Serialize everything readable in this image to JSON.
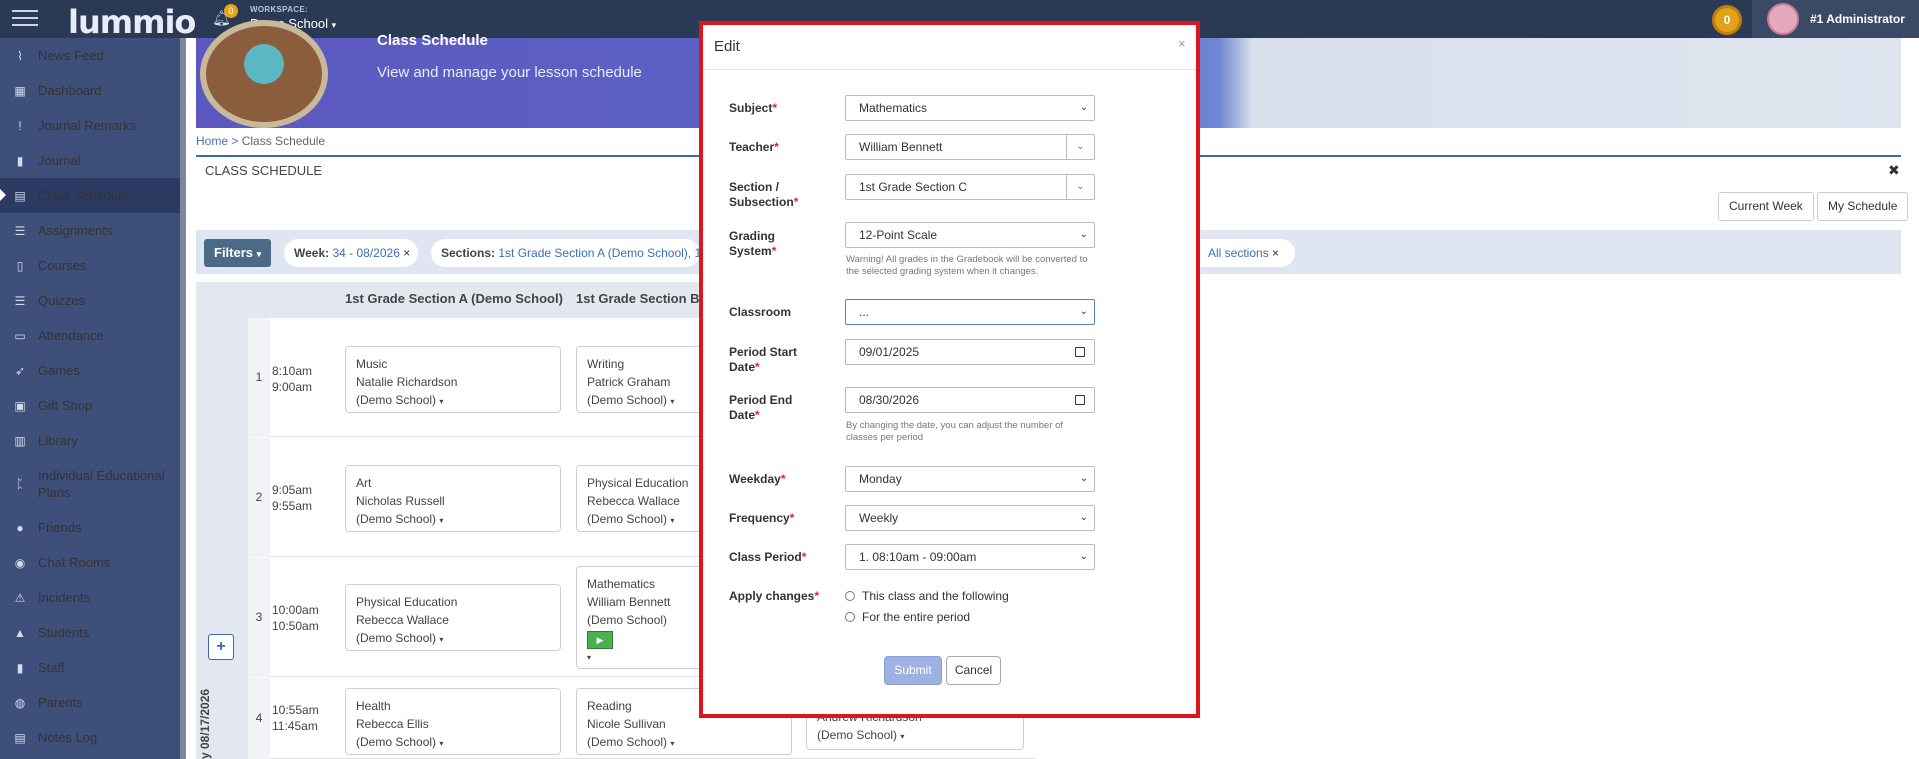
{
  "topbar": {
    "logo": "lummio",
    "notification_count": "0",
    "workspace_label": "WORKSPACE:",
    "workspace_name": "Demo School",
    "coins": "0",
    "username": "#1 Administrator"
  },
  "sidebar": {
    "items": [
      {
        "label": "News Feed",
        "icon": "rss-icon"
      },
      {
        "label": "Dashboard",
        "icon": "dashboard-icon"
      },
      {
        "label": "Journal Remarks",
        "icon": "exclamation-icon"
      },
      {
        "label": "Journal",
        "icon": "bookmark-icon"
      },
      {
        "label": "Class Schedule",
        "icon": "calendar-icon"
      },
      {
        "label": "Assignments",
        "icon": "list-icon"
      },
      {
        "label": "Courses",
        "icon": "book-icon"
      },
      {
        "label": "Quizzes",
        "icon": "list-icon"
      },
      {
        "label": "Attendance",
        "icon": "clipboard-icon"
      },
      {
        "label": "Games",
        "icon": "rocket-icon"
      },
      {
        "label": "Gift Shop",
        "icon": "gift-icon"
      },
      {
        "label": "Library",
        "icon": "library-icon"
      },
      {
        "label": "Individual Educational Plans",
        "icon": "plan-icon"
      },
      {
        "label": "Friends",
        "icon": "users-icon"
      },
      {
        "label": "Chat Rooms",
        "icon": "chat-icon"
      },
      {
        "label": "Incidents",
        "icon": "warning-icon"
      },
      {
        "label": "Students",
        "icon": "graduation-icon"
      },
      {
        "label": "Staff",
        "icon": "staff-icon"
      },
      {
        "label": "Parents",
        "icon": "parents-icon"
      },
      {
        "label": "Notes Log",
        "icon": "notes-icon"
      }
    ]
  },
  "page": {
    "banner_title": "Class Schedule",
    "banner_subtitle": "View and manage your lesson schedule",
    "breadcrumb_home": "Home",
    "breadcrumb_sep": ">",
    "breadcrumb_current": "Class Schedule",
    "schedule_title": "CLASS SCHEDULE",
    "current_week": "Current Week",
    "my_schedule": "My Schedule",
    "filters": "Filters",
    "week_key": "Week:",
    "week_value": "34 - 08/2026",
    "sections_key": "Sections:",
    "sections_value": "1st Grade Section A (Demo School), 1",
    "all_sections": "All sections",
    "col1": "1st Grade Section A (Demo School)",
    "col2": "1st Grade Section B",
    "week_label": "y 08/17/2026"
  },
  "rows": [
    {
      "num": "1",
      "start": "8:10am",
      "end": "9:00am",
      "a": {
        "subject": "Music",
        "teacher": "Natalie Richardson",
        "school": "(Demo School)"
      },
      "b": {
        "subject": "Writing",
        "teacher": "Patrick Graham",
        "school": "(Demo School)"
      }
    },
    {
      "num": "2",
      "start": "9:05am",
      "end": "9:55am",
      "a": {
        "subject": "Art",
        "teacher": "Nicholas Russell",
        "school": "(Demo School)"
      },
      "b": {
        "subject": "Physical Education",
        "teacher": "Rebecca Wallace",
        "school": "(Demo School)"
      }
    },
    {
      "num": "3",
      "start": "10:00am",
      "end": "10:50am",
      "a": {
        "subject": "Physical Education",
        "teacher": "Rebecca Wallace",
        "school": "(Demo School)"
      },
      "b": {
        "subject": "Mathematics",
        "teacher": "William Bennett",
        "school": "(Demo School)"
      }
    },
    {
      "num": "4",
      "start": "10:55am",
      "end": "11:45am",
      "a": {
        "subject": "Health",
        "teacher": "Rebecca Ellis",
        "school": "(Demo School)"
      },
      "b": {
        "subject": "Reading",
        "teacher": "Nicole Sullivan",
        "school": "(Demo School)"
      },
      "c": {
        "teacher": "Andrew Richardson",
        "school": "(Demo School)"
      }
    }
  ],
  "modal": {
    "title": "Edit",
    "close": "×",
    "subject_label": "Subject",
    "subject_value": "Mathematics",
    "teacher_label": "Teacher",
    "teacher_value": "William Bennett",
    "section_label_1": "Section /",
    "section_label_2": "Subsection",
    "section_value": "1st Grade Section C",
    "grading_label_1": "Grading",
    "grading_label_2": "System",
    "grading_value": "12-Point Scale",
    "grading_hint": "Warning! All grades in the Gradebook will be converted to the selected grading system when it changes.",
    "classroom_label": "Classroom",
    "classroom_value": "...",
    "start_label_1": "Period Start",
    "start_label_2": "Date",
    "start_value": "09/01/2025",
    "end_label_1": "Period End",
    "end_label_2": "Date",
    "end_value": "08/30/2026",
    "end_hint": "By changing the date, you can adjust the number of classes per period",
    "weekday_label": "Weekday",
    "weekday_value": "Monday",
    "frequency_label": "Frequency",
    "frequency_value": "Weekly",
    "period_label": "Class Period",
    "period_value": "1. 08:10am - 09:00am",
    "apply_label": "Apply changes",
    "apply_opt1": "This class and the following",
    "apply_opt2": "For the entire period",
    "submit": "Submit",
    "cancel": "Cancel",
    "required_mark": "*"
  },
  "colors": {
    "sidebar_bg": "#3e4f79",
    "topbar_bg": "#2a3a55",
    "modal_highlight": "#e0141b",
    "required": "#d02e2e",
    "submit_bg": "#9db1e3"
  }
}
